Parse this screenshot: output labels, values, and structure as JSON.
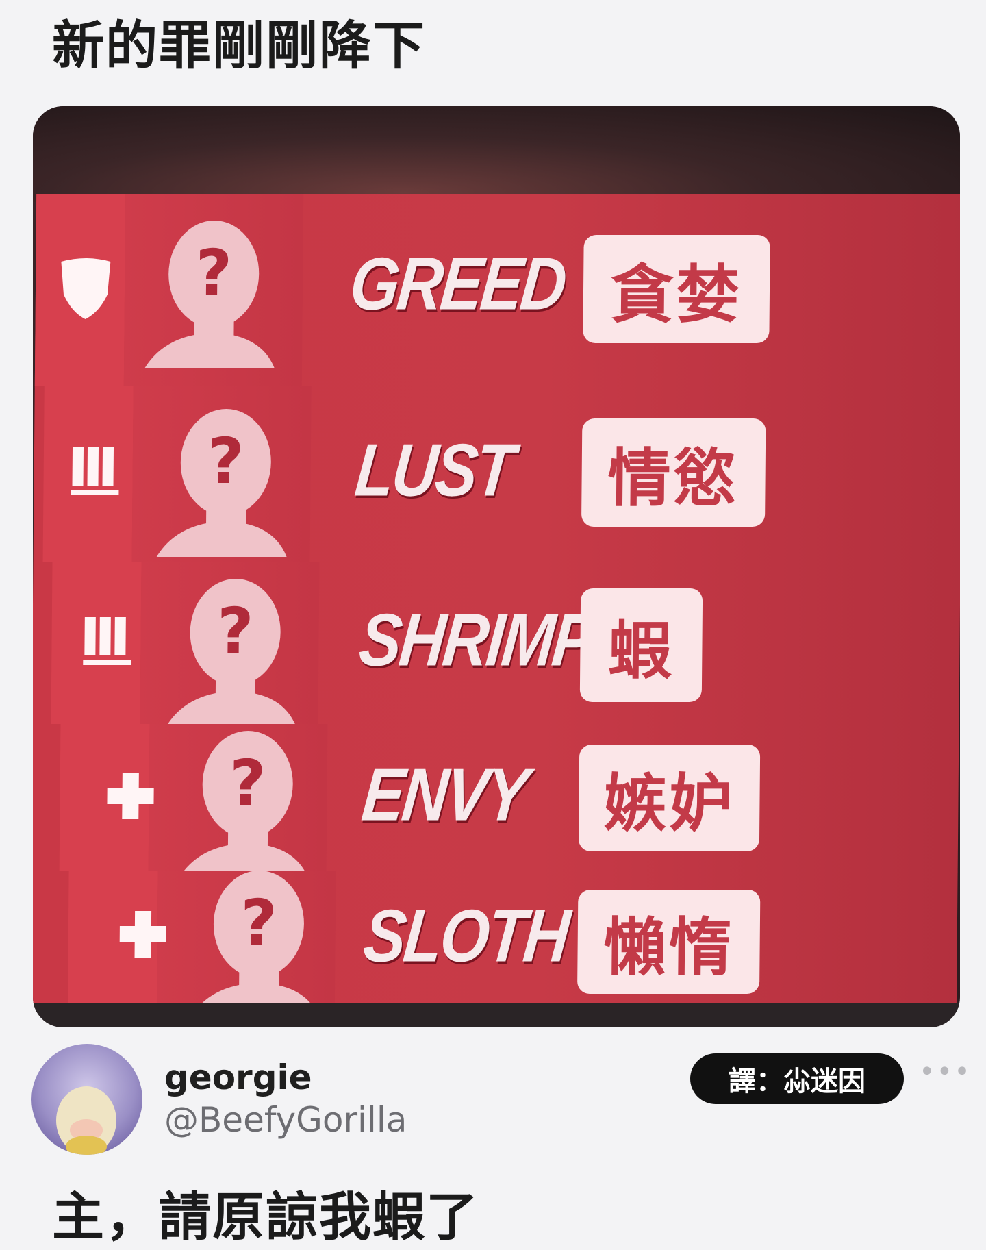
{
  "header": {
    "caption": "新的罪剛剛降下"
  },
  "rows": [
    {
      "name": "GREED",
      "translation": "貪婪",
      "role_icon": "shield-icon",
      "glyph": "?"
    },
    {
      "name": "LUST",
      "translation": "情慾",
      "role_icon": "ammo-icon",
      "glyph": "?"
    },
    {
      "name": "SHRIMP",
      "translation": "蝦",
      "role_icon": "ammo-icon",
      "glyph": "?"
    },
    {
      "name": "ENVY",
      "translation": "嫉妒",
      "role_icon": "health-cross-icon",
      "glyph": "?"
    },
    {
      "name": "SLOTH",
      "translation": "懶惰",
      "role_icon": "health-cross-icon",
      "glyph": "?"
    }
  ],
  "author": {
    "name": "georgie",
    "handle": "@BeefyGorilla",
    "credit": "譯：尛迷因",
    "more": "•••"
  },
  "tweet": {
    "text": "主，請原諒我蝦了"
  },
  "colors": {
    "row_red": "#c93846",
    "tag_bg": "#fbe6e8",
    "tag_text": "#c33a48"
  }
}
